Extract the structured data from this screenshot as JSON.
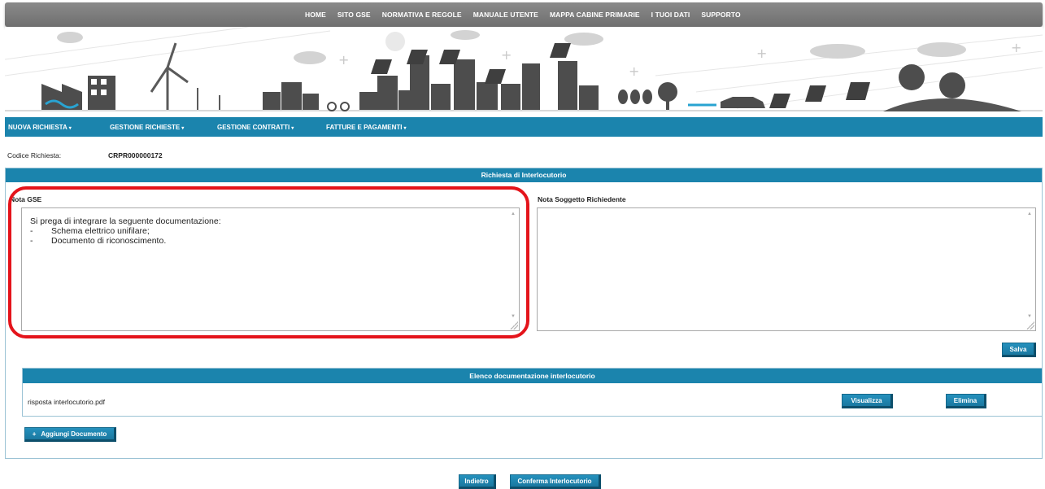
{
  "top_nav": [
    "HOME",
    "SITO GSE",
    "NORMATIVA E REGOLE",
    "MANUALE UTENTE",
    "MAPPA CABINE PRIMARIE",
    "I TUOI DATI",
    "SUPPORTO"
  ],
  "main_menu": {
    "nuova_richiesta": "NUOVA RICHIESTA",
    "gestione_richieste": "GESTIONE RICHIESTE",
    "gestione_contratti": "GESTIONE CONTRATTI",
    "fatture_pagamenti": "FATTURE E PAGAMENTI",
    "caret": "▾"
  },
  "codice": {
    "label": "Codice Richiesta:",
    "value": "CRPR000000172"
  },
  "panel": {
    "title": "Richiesta di Interlocutorio",
    "nota_gse_label": "Nota GSE",
    "nota_richiedente_label": "Nota Soggetto Richiedente",
    "nota_gse_intro": "Si prega di integrare la seguente documentazione:",
    "nota_gse_items": [
      "Schema elettrico unifilare;",
      "Documento di riconoscimento."
    ],
    "bullet": "-",
    "salva": "Salva"
  },
  "documents": {
    "title": "Elenco documentazione interlocutorio",
    "rows": [
      {
        "filename": "risposta interlocutorio.pdf",
        "view": "Visualizza",
        "delete": "Elimina"
      }
    ],
    "add": "Aggiungi Documento",
    "add_icon": "+"
  },
  "footer": {
    "back": "Indietro",
    "confirm": "Conferma Interlocutorio"
  },
  "colors": {
    "accent": "#1b84ad",
    "highlight": "#e4141b",
    "nav_grey": "#7a7a7a"
  }
}
